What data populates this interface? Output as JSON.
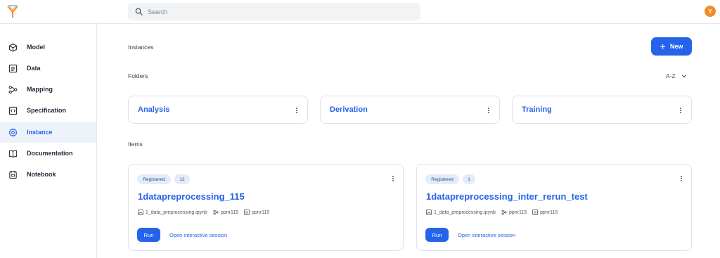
{
  "search": {
    "placeholder": "Search"
  },
  "user": {
    "initial": "Y"
  },
  "colors": {
    "accent": "#2563eb",
    "avatar": "#f28c28",
    "active_bg": "#eef3fb"
  },
  "sidebar": {
    "items": [
      {
        "label": "Model",
        "icon": "cube-icon"
      },
      {
        "label": "Data",
        "icon": "table-icon"
      },
      {
        "label": "Mapping",
        "icon": "flow-icon"
      },
      {
        "label": "Specification",
        "icon": "code-icon"
      },
      {
        "label": "Instance",
        "icon": "gear-icon",
        "active": true
      },
      {
        "label": "Documentation",
        "icon": "book-icon"
      },
      {
        "label": "Notebook",
        "icon": "notebook-icon"
      }
    ]
  },
  "main": {
    "section_title": "Instances",
    "new_button": {
      "label": "New"
    },
    "folders_label": "Folders",
    "sort_label": "A-Z",
    "folders": [
      {
        "name": "Analysis"
      },
      {
        "name": "Derivation"
      },
      {
        "name": "Training"
      }
    ],
    "items_label": "Items",
    "items": [
      {
        "status": "Registered",
        "count": "12",
        "title": "1datapreprocessing_115",
        "notebook_file": "1_data_preprocessing.ipynb",
        "mapping": "ppnr115",
        "spec": "ppnr115",
        "run_label": "Run",
        "session_label": "Open interactive session"
      },
      {
        "status": "Registered",
        "count": "1",
        "title": "1datapreprocessing_inter_rerun_test",
        "notebook_file": "1_data_preprocessing.ipynb",
        "mapping": "ppnr115",
        "spec": "ppnr115",
        "run_label": "Run",
        "session_label": "Open interactive session"
      }
    ]
  }
}
